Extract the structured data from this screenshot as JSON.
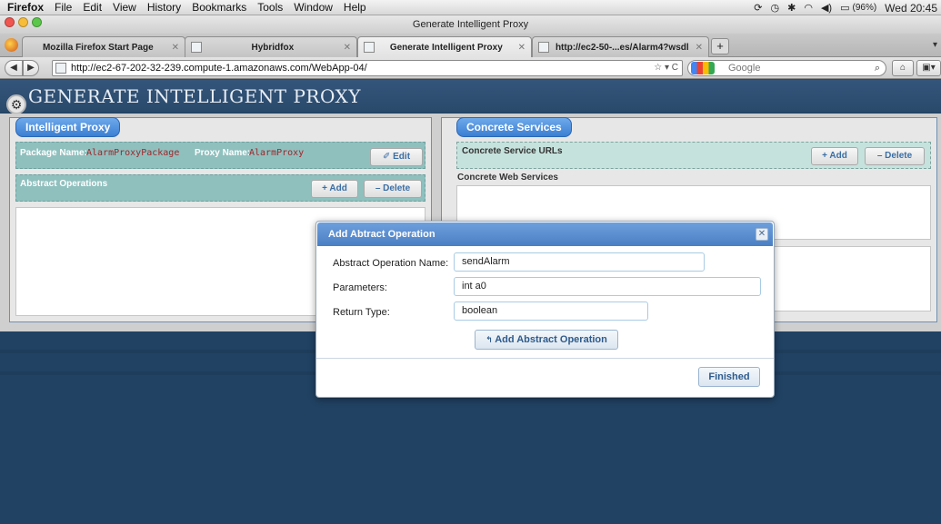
{
  "menubar": {
    "app": "Firefox",
    "items": [
      "File",
      "Edit",
      "View",
      "History",
      "Bookmarks",
      "Tools",
      "Window",
      "Help"
    ],
    "battery": "(96%)",
    "clock": "Wed 20:45"
  },
  "window": {
    "title": "Generate Intelligent Proxy"
  },
  "tabs": [
    {
      "label": "Mozilla Firefox Start Page"
    },
    {
      "label": "Hybridfox"
    },
    {
      "label": "Generate Intelligent Proxy"
    },
    {
      "label": "http://ec2-50-...es/Alarm4?wsdl"
    }
  ],
  "nav": {
    "url": "http://ec2-67-202-32-239.compute-1.amazonaws.com/WebApp-04/",
    "search_placeholder": "Google"
  },
  "app": {
    "title": "GENERATE INTELLIGENT PROXY",
    "left_panel": {
      "title": "Intelligent Proxy",
      "package_label": "Package Name:",
      "package_value": "AlarmProxyPackage",
      "proxy_label": "Proxy Name:",
      "proxy_value": "AlarmProxy",
      "edit_label": "Edit",
      "ops_label": "Abstract Operations",
      "add_label": "Add",
      "delete_label": "Delete"
    },
    "right_panel": {
      "title": "Concrete Services",
      "urls_label": "Concrete Service URLs",
      "add_label": "Add",
      "delete_label": "Delete",
      "ws_label": "Concrete Web Services"
    }
  },
  "modal": {
    "title": "Add Abtract Operation",
    "fields": [
      {
        "label": "Abstract Operation Name:",
        "value": "sendAlarm"
      },
      {
        "label": "Parameters:",
        "value": "int a0"
      },
      {
        "label": "Return Type:",
        "value": "boolean"
      }
    ],
    "add_button": "Add Abstract Operation",
    "finished_button": "Finished"
  }
}
